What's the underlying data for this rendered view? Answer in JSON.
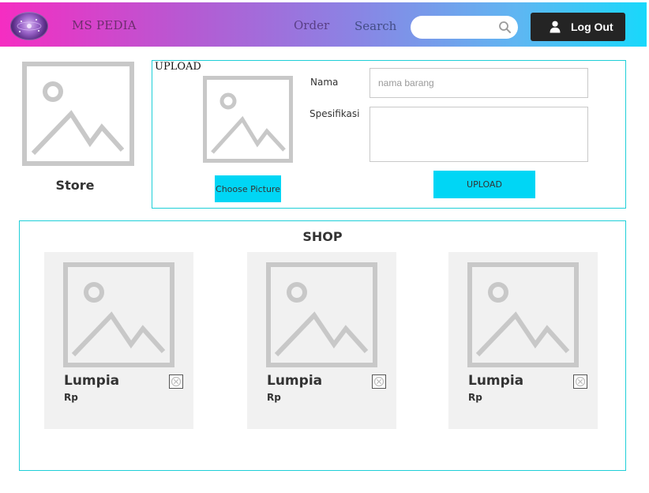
{
  "header": {
    "brand": "MS PEDIA",
    "nav": {
      "order": "Order",
      "search": "Search"
    },
    "search": {
      "value": "",
      "placeholder": ""
    },
    "logout_label": "Log Out"
  },
  "store": {
    "label": "Store"
  },
  "upload": {
    "title": "UPLOAD",
    "choose_label": "Choose Picture",
    "nama_label": "Nama",
    "nama_placeholder": "nama barang",
    "nama_value": "",
    "spesifikasi_label": "Spesifikasi",
    "spesifikasi_value": "",
    "upload_label": "UPLOAD"
  },
  "shop": {
    "title": "SHOP",
    "items": [
      {
        "name": "Lumpia",
        "price": "Rp"
      },
      {
        "name": "Lumpia",
        "price": "Rp"
      },
      {
        "name": "Lumpia",
        "price": "Rp"
      }
    ]
  },
  "colors": {
    "accent": "#00d6f5",
    "panel_border": "#1fcfd8",
    "header_gradient_start": "#f52dc2",
    "header_gradient_end": "#18d8fb",
    "logout_bg": "#242424",
    "card_bg": "#f1f1f1",
    "placeholder_gray": "#c8c8c8"
  },
  "icons": {
    "logo": "galaxy-logo-icon",
    "search": "search-icon",
    "user": "user-icon",
    "placeholder": "image-placeholder-icon",
    "delete": "close-box-icon"
  }
}
